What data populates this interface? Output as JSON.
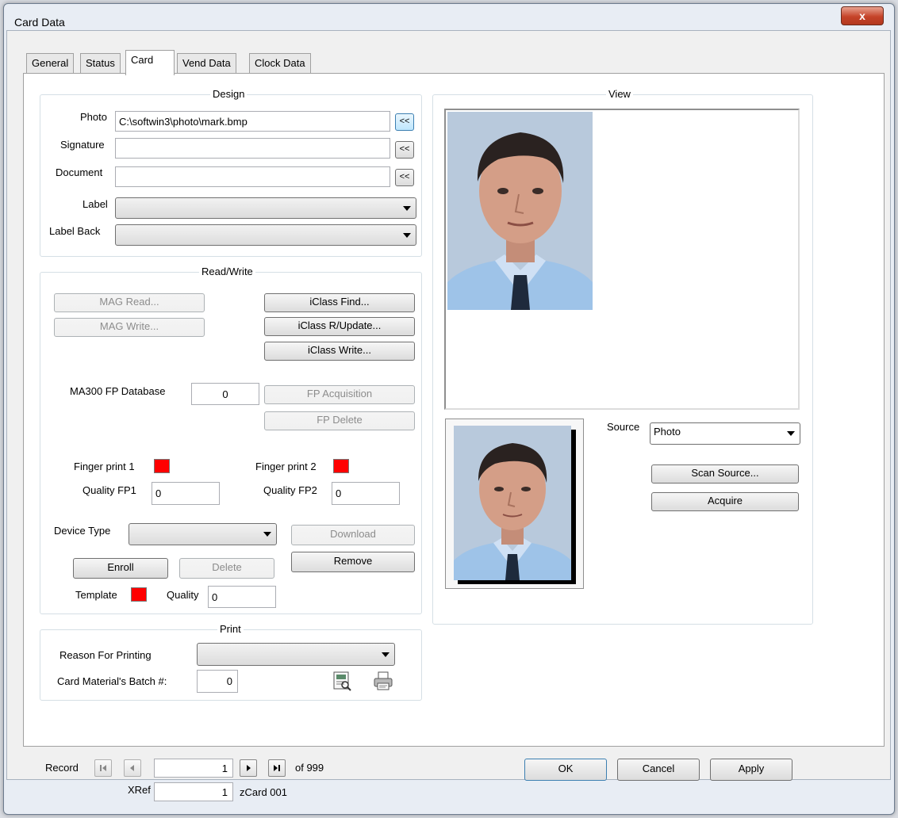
{
  "window": {
    "title": "Card Data",
    "close_label": "x"
  },
  "tabs": [
    {
      "label": "General"
    },
    {
      "label": "Status"
    },
    {
      "label": "Card"
    },
    {
      "label": "Vend Data"
    },
    {
      "label": "Clock Data"
    }
  ],
  "design": {
    "title": "Design",
    "photo_label": "Photo",
    "photo_value": "C:\\softwin3\\photo\\mark.bmp",
    "signature_label": "Signature",
    "signature_value": "",
    "document_label": "Document",
    "document_value": "",
    "browse_label": "<<",
    "label_label": "Label",
    "label_value": "",
    "label_back_label": "Label Back",
    "label_back_value": ""
  },
  "readwrite": {
    "title": "Read/Write",
    "mag_read": "MAG Read...",
    "mag_write": "MAG Write...",
    "iclass_find": "iClass Find...",
    "iclass_update": "iClass R/Update...",
    "iclass_write": "iClass Write...",
    "fp_db_label": "MA300 FP Database",
    "fp_db_value": "0",
    "fp_acquisition": "FP Acquisition",
    "fp_delete": "FP Delete",
    "finger1_label": "Finger print 1",
    "finger2_label": "Finger print 2",
    "quality1_label": "Quality FP1",
    "quality1_value": "0",
    "quality2_label": "Quality FP2",
    "quality2_value": "0",
    "device_type_label": "Device Type",
    "device_type_value": "",
    "download": "Download",
    "enroll": "Enroll",
    "delete": "Delete",
    "remove": "Remove",
    "template_label": "Template",
    "quality_label": "Quality",
    "quality_value": "0",
    "status_color": "#ff0000"
  },
  "print": {
    "title": "Print",
    "reason_label": "Reason For Printing",
    "reason_value": "",
    "batch_label": "Card Material's Batch #:",
    "batch_value": "0"
  },
  "view": {
    "title": "View",
    "source_label": "Source",
    "source_value": "Photo",
    "scan_source": "Scan Source...",
    "acquire": "Acquire"
  },
  "footer": {
    "record_label": "Record",
    "record_value": "1",
    "of_total": "of 999",
    "xref_label": "XRef",
    "xref_value": "1",
    "xref_name": "zCard 001",
    "ok": "OK",
    "cancel": "Cancel",
    "apply": "Apply"
  }
}
